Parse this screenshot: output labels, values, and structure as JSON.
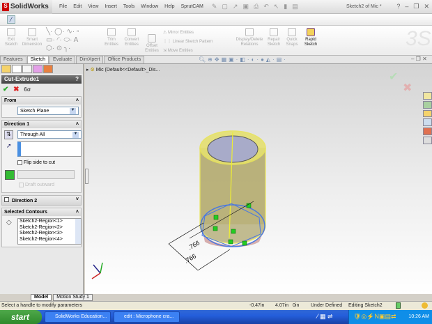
{
  "app": {
    "name": "SolidWorks",
    "doc_title": "Sketch2 of Mic *",
    "help": "?"
  },
  "menu": [
    "File",
    "Edit",
    "View",
    "Insert",
    "Tools",
    "Window",
    "Help",
    "SprutCAM"
  ],
  "toolbar": [
    {
      "label": "Exit Sketch",
      "active": false
    },
    {
      "label": "Smart Dimension",
      "active": false
    },
    {
      "label": "Trim Entities",
      "active": false
    },
    {
      "label": "Convert Entities",
      "active": false
    },
    {
      "label": "Offset Entities",
      "active": false
    },
    {
      "label": "Mirror Entities",
      "active": false
    },
    {
      "label": "Linear Sketch Pattern",
      "active": false
    },
    {
      "label": "Move Entities",
      "active": false
    },
    {
      "label": "Display/Delete Relations",
      "active": false
    },
    {
      "label": "Repair Sketch",
      "active": false
    },
    {
      "label": "Quick Snaps",
      "active": false
    },
    {
      "label": "Rapid Sketch",
      "active": true
    }
  ],
  "tabs": [
    "Features",
    "Sketch",
    "Evaluate",
    "DimXpert",
    "Office Products"
  ],
  "selected_tab": "Sketch",
  "property_manager": {
    "title": "Cut-Extrude1",
    "from": {
      "label": "From",
      "value": "Sketch Plane"
    },
    "direction1": {
      "label": "Direction 1",
      "end_condition": "Through All",
      "flip_label": "Flip side to cut",
      "flip_checked": false,
      "draft_label": "Draft outward"
    },
    "direction2": {
      "label": "Direction 2",
      "checked": false
    },
    "contours": {
      "label": "Selected Contours",
      "items": [
        "Sketch2-Region<1>",
        "Sketch2-Region<2>",
        "Sketch2-Region<3>",
        "Sketch2-Region<4>"
      ]
    }
  },
  "viewport": {
    "tree_label": "Mic  (Default<<Default>_Dis...",
    "dimensions": [
      ".766",
      ".766"
    ]
  },
  "bottom_tabs": [
    "Model",
    "Motion Study 1"
  ],
  "status": {
    "message": "Select a handle to modify parameters",
    "x": "-0.47in",
    "y": "4.07in",
    "z": "0in",
    "state": "Under Defined",
    "editing": "Editing Sketch2"
  },
  "taskbar": {
    "start": "start",
    "tasks": [
      "SolidWorks Education...",
      "edit : Microphone cra..."
    ],
    "clock": "10:26 AM"
  }
}
